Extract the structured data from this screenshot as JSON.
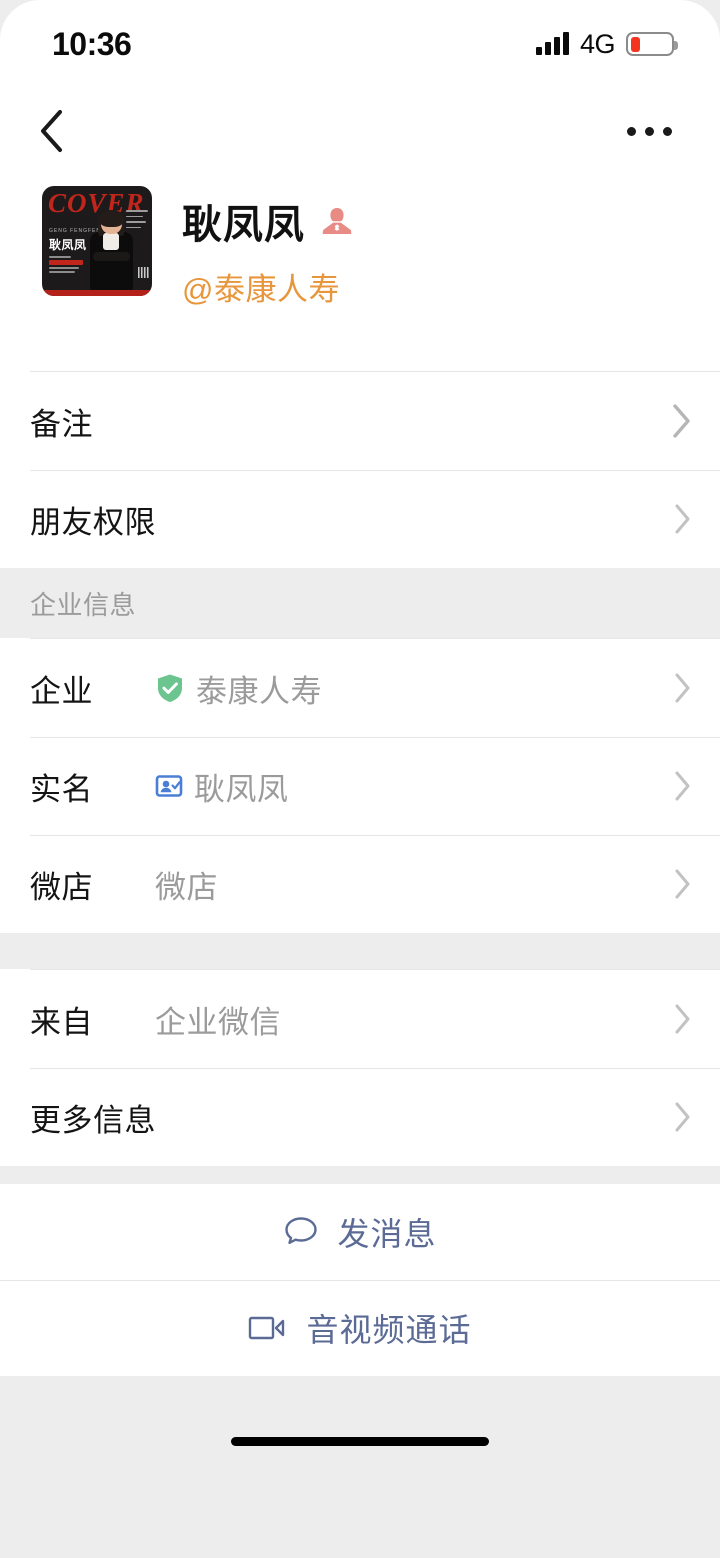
{
  "status_bar": {
    "time": "10:36",
    "network": "4G",
    "signal_icon": "signal-bars-icon",
    "battery_icon": "battery-low-icon",
    "battery_level_percent": 25,
    "battery_color": "#f4341f"
  },
  "nav": {
    "back_icon": "chevron-left-icon",
    "more_icon": "more-options-icon"
  },
  "profile": {
    "avatar_alt": "magazine-cover-avatar",
    "avatar_cover_text": "COVER",
    "avatar_name_en": "GENG FENGFENG",
    "avatar_name_cn": "耿凤凤",
    "name": "耿凤凤",
    "gender_icon": "female-avatar-icon",
    "gender_color": "#e98b85",
    "alias": "@泰康人寿",
    "alias_color": "#e8963c"
  },
  "list": {
    "group1": [
      {
        "label": "备注",
        "value": "",
        "icon": "",
        "chevron": "chevron-right-icon"
      },
      {
        "label": "朋友权限",
        "value": "",
        "icon": "",
        "chevron": "chevron-right-icon"
      }
    ],
    "section_title": "企业信息",
    "group2": [
      {
        "label": "企业",
        "value": "泰康人寿",
        "icon": "verified-shield-icon",
        "chevron": "chevron-right-icon"
      },
      {
        "label": "实名",
        "value": "耿凤凤",
        "icon": "id-card-icon",
        "chevron": "chevron-right-icon"
      },
      {
        "label": "微店",
        "value": "微店",
        "icon": "",
        "chevron": "chevron-right-icon"
      }
    ],
    "group3": [
      {
        "label": "来自",
        "value": "企业微信",
        "icon": "",
        "chevron": "chevron-right-icon"
      },
      {
        "label": "更多信息",
        "value": "",
        "icon": "",
        "chevron": "chevron-right-icon"
      }
    ]
  },
  "actions": [
    {
      "label": "发消息",
      "icon": "chat-bubble-icon"
    },
    {
      "label": "音视频通话",
      "icon": "video-camera-icon"
    }
  ],
  "colors": {
    "accent_blue": "#5b6b95",
    "verified_green": "#6cc48f",
    "id_blue": "#4a7fd4",
    "page_bg": "#ededed",
    "card_bg": "#ffffff",
    "divider": "#e6e6e6",
    "secondary_text": "#9b9b9b"
  }
}
